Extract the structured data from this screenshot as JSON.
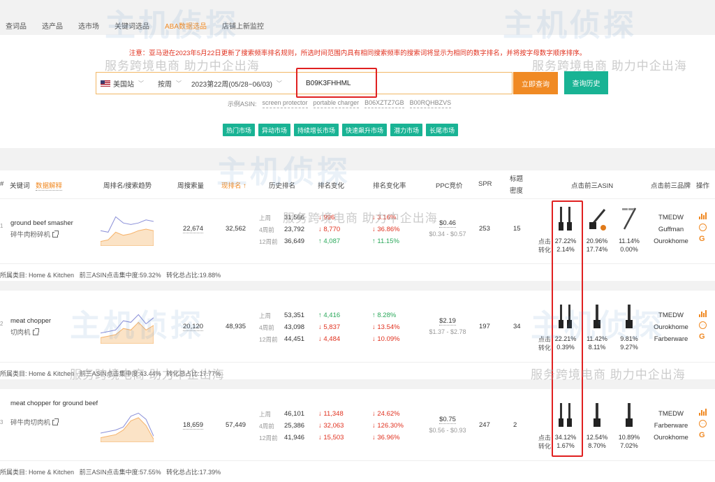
{
  "nav": {
    "items": [
      "查词品",
      "选产品",
      "选市场",
      "关键词选品",
      "ABA数据选品",
      "店铺上新监控"
    ],
    "active_index": 4
  },
  "notice": "注意：亚马逊在2023年5月22日更新了搜索频率排名规则，所选时间范围内具有相同搜索频率的搜索词将显示为相同的数字排名，并将按字母数字顺序排序。",
  "search": {
    "site": "美国站",
    "period_type": "按周",
    "week": "2023第22周(05/28~06/03)",
    "asin_value": "B09K3FHHML",
    "query_button": "立即查询",
    "history_button": "查询历史",
    "examples_label": "示例ASIN:",
    "examples": [
      "screen protector",
      "portable charger",
      "B06XZTZ7GB",
      "B00RQHBZVS"
    ]
  },
  "markets": [
    "热门市场",
    "异动市场",
    "持续增长市场",
    "快速飙升市场",
    "潜力市场",
    "长尾市场"
  ],
  "table": {
    "headers": {
      "index": "#",
      "keyword": "关键词",
      "data_explain": "数据解释",
      "trend": "周排名/搜索趋势",
      "volume": "周搜索量",
      "current_rank": "现排名",
      "history_rank": "历史排名",
      "rank_change": "排名变化",
      "rank_change_rate": "排名变化率",
      "ppc": "PPC竞价",
      "spr": "SPR",
      "title_density_1": "标题",
      "title_density_2": "密度",
      "top3_asin": "点击前三ASIN",
      "top3_brand": "点击前三品牌",
      "ops": "操作"
    },
    "history_labels": [
      "上周",
      "4周前",
      "12周前"
    ],
    "click_label": "点击",
    "convert_label": "转化",
    "rows": [
      {
        "index": "1",
        "keyword": "ground beef smasher",
        "keyword_zh": "碎牛肉粉碎机",
        "volume": "22,674",
        "current_rank": "32,562",
        "history": [
          "31,566",
          "23,792",
          "36,649"
        ],
        "changes": [
          "↓ 996",
          "↓ 8,770",
          "↑ 4,087"
        ],
        "change_dirs": [
          "down",
          "down",
          "up"
        ],
        "rates": [
          "↓ 3.16%",
          "↓ 36.86%",
          "↑ 11.15%"
        ],
        "ppc": "$0.46",
        "ppc_range": "$0.34 - $0.57",
        "spr": "253",
        "title_density": "15",
        "asins": [
          {
            "click": "27.22%",
            "conv": "2.14%"
          },
          {
            "click": "20.96%",
            "conv": "17.74%"
          },
          {
            "click": "11.14%",
            "conv": "0.00%"
          }
        ],
        "brands": [
          "TMEDW",
          "Guffman",
          "Ourokhome"
        ],
        "category": "所属类目: Home & Kitchen",
        "concentration": "前三ASIN点击集中度:59.32%",
        "conversion_share": "转化总占比:19.88%",
        "trend_points": [
          0.55,
          0.6,
          0.1,
          0.3,
          0.35,
          0.3,
          0.2,
          0.25
        ],
        "area_points": [
          0.9,
          0.85,
          0.6,
          0.7,
          0.65,
          0.55,
          0.5,
          0.55
        ]
      },
      {
        "index": "2",
        "keyword": "meat chopper",
        "keyword_zh": "切肉机",
        "volume": "20,120",
        "current_rank": "48,935",
        "history": [
          "53,351",
          "43,098",
          "44,451"
        ],
        "changes": [
          "↑ 4,416",
          "↓ 5,837",
          "↓ 4,484"
        ],
        "change_dirs": [
          "up",
          "down",
          "down"
        ],
        "rates": [
          "↑ 8.28%",
          "↓ 13.54%",
          "↓ 10.09%"
        ],
        "ppc": "$2.19",
        "ppc_range": "$1.37 - $2.78",
        "spr": "197",
        "title_density": "34",
        "asins": [
          {
            "click": "22.21%",
            "conv": "0.39%"
          },
          {
            "click": "11.42%",
            "conv": "8.11%"
          },
          {
            "click": "9.81%",
            "conv": "9.27%"
          }
        ],
        "brands": [
          "TMEDW",
          "Ourokhome",
          "Farberware"
        ],
        "category": "所属类目: Home & Kitchen",
        "concentration": "前三ASIN点击集中度:43.44%",
        "conversion_share": "转化总占比:17.77%",
        "trend_points": [
          0.7,
          0.65,
          0.6,
          0.3,
          0.35,
          0.1,
          0.4,
          0.2
        ],
        "area_points": [
          0.85,
          0.8,
          0.75,
          0.55,
          0.6,
          0.35,
          0.6,
          0.45
        ]
      },
      {
        "index": "3",
        "keyword": "meat chopper for ground beef",
        "keyword_zh": "碎牛肉切肉机",
        "volume": "18,659",
        "current_rank": "57,449",
        "history": [
          "46,101",
          "25,386",
          "41,946"
        ],
        "changes": [
          "↓ 11,348",
          "↓ 32,063",
          "↓ 15,503"
        ],
        "change_dirs": [
          "down",
          "down",
          "down"
        ],
        "rates": [
          "↓ 24.62%",
          "↓ 126.30%",
          "↓ 36.96%"
        ],
        "ppc": "$0.75",
        "ppc_range": "$0.56 - $0.93",
        "spr": "247",
        "title_density": "2",
        "asins": [
          {
            "click": "34.12%",
            "conv": "1.67%"
          },
          {
            "click": "12.54%",
            "conv": "8.70%"
          },
          {
            "click": "10.89%",
            "conv": "7.02%"
          }
        ],
        "brands": [
          "TMEDW",
          "Farberware",
          "Ourokhome"
        ],
        "category": "所属类目: Home & Kitchen",
        "concentration": "前三ASIN点击集中度:57.55%",
        "conversion_share": "转化总占比:17.39%",
        "trend_points": [
          0.75,
          0.7,
          0.65,
          0.55,
          0.2,
          0.1,
          0.3,
          0.85
        ],
        "area_points": [
          0.9,
          0.85,
          0.8,
          0.65,
          0.35,
          0.25,
          0.5,
          0.95
        ]
      }
    ]
  },
  "watermark": {
    "big": "主机侦探",
    "small": "服务跨境电商 助力中企出海"
  },
  "colors": {
    "accent": "#f08a24",
    "teal": "#19b394",
    "red": "#e0301e",
    "green": "#2aa85a",
    "highlight": "#e02020"
  }
}
